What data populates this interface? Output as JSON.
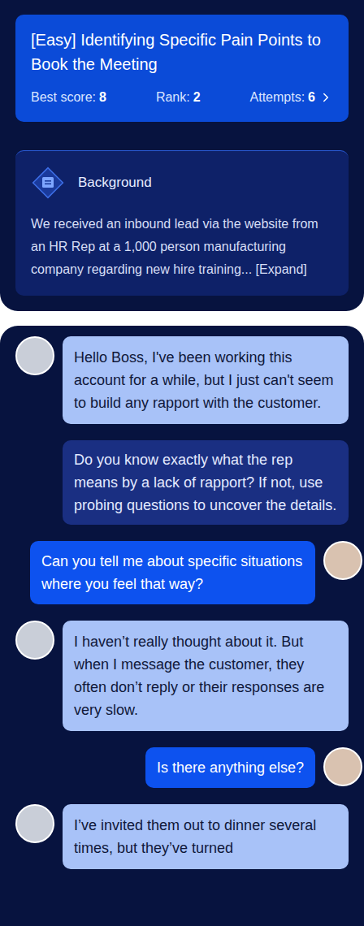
{
  "challenge": {
    "title": "[Easy] Identifying Specific Pain Points to Book the Meeting",
    "stats": [
      {
        "label": "Best score:",
        "value": "8"
      },
      {
        "label": "Rank:",
        "value": "2"
      },
      {
        "label": "Attempts:",
        "value": "6"
      }
    ]
  },
  "background": {
    "heading": "Background",
    "text": "We received an inbound lead via the website from an HR Rep at a 1,000 person manufacturing company regarding new hire training...",
    "expand": "[Expand]"
  },
  "messages": [
    {
      "kind": "rep",
      "text": "Hello Boss, I've been working this account for a while, but I just can't seem to build any rapport with the customer."
    },
    {
      "kind": "hint",
      "text": "Do you know exactly what the rep means by a lack of rapport? If not, use probing questions to uncover the details."
    },
    {
      "kind": "user",
      "text": "Can you tell me about specific situations where you feel that way?"
    },
    {
      "kind": "rep",
      "text": "I haven’t really thought about it. But when I message the customer, they often don’t reply or their responses are very slow."
    },
    {
      "kind": "user",
      "text": "Is there anything else?"
    },
    {
      "kind": "rep",
      "text": "I’ve invited them out to dinner several times, but they’ve turned"
    }
  ]
}
